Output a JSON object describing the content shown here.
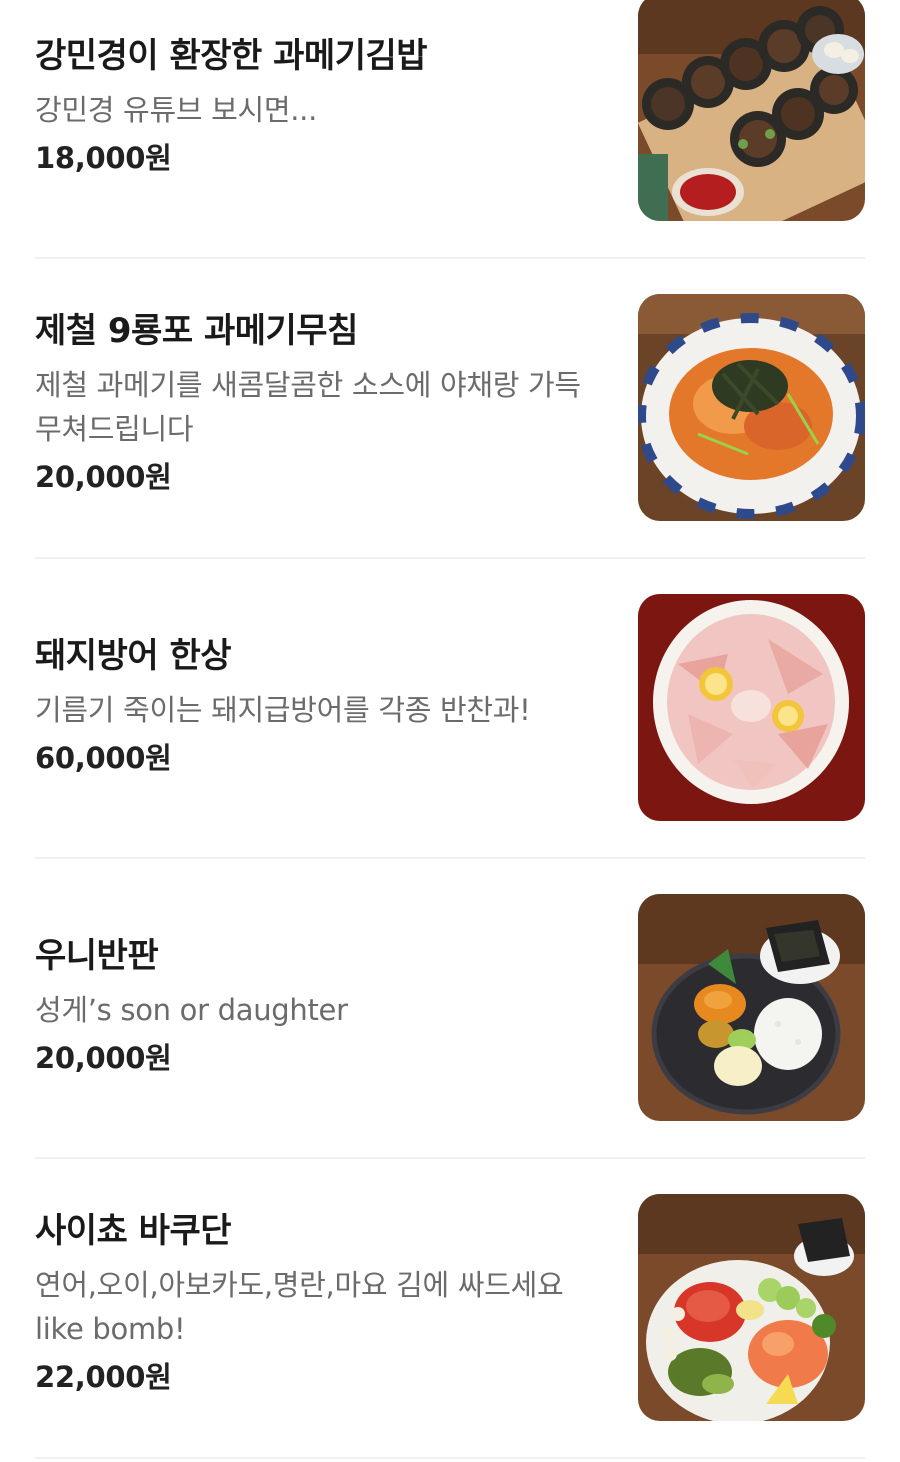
{
  "menu": {
    "items": [
      {
        "name": "강민경이 환장한 과메기김밥",
        "description": "강민경 유튜브 보시면...",
        "price": "18,000원",
        "image": "gimbap-photo"
      },
      {
        "name": "제철 9룡포 과메기무침",
        "description": "제철 과메기를 새콤달콤한 소스에 야채랑 가득 무쳐드립니다",
        "price": "20,000원",
        "image": "gwamegi-salad-photo"
      },
      {
        "name": "돼지방어 한상",
        "description": "기름기 죽이는 돼지급방어를 각종 반찬과!",
        "price": "60,000원",
        "image": "yellowtail-sashimi-photo"
      },
      {
        "name": "우니반판",
        "description": "성게’s son or daughter",
        "price": "20,000원",
        "image": "uni-plate-photo"
      },
      {
        "name": "사이쵸 바쿠단",
        "description": "연어,오이,아보카도,명란,마요 김에 싸드세요 like bomb!",
        "price": "22,000원",
        "image": "bakudan-bowl-photo"
      }
    ]
  },
  "colors": {
    "name": "#1a1a1a",
    "description": "#6b6b6b",
    "price": "#222222",
    "divider": "#f0f0f0"
  }
}
